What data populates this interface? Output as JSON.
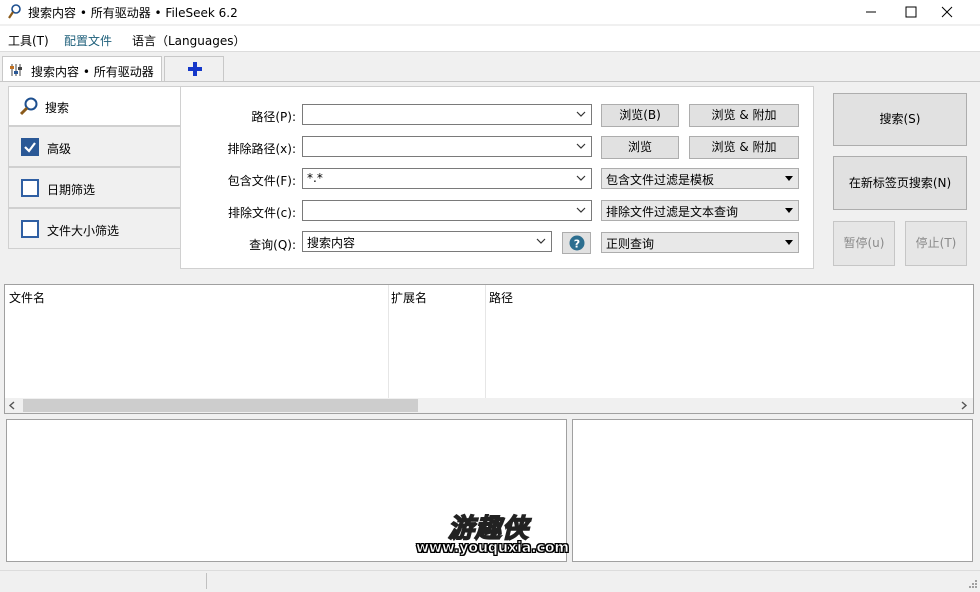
{
  "window": {
    "title": "搜索内容 • 所有驱动器 • FileSeek 6.2"
  },
  "menu": {
    "items": [
      {
        "label": "工具(T)"
      },
      {
        "label": "配置文件"
      },
      {
        "label": "语言（Languages）"
      }
    ]
  },
  "tabs": {
    "active_label": "搜索内容 • 所有驱动器"
  },
  "side_tabs": [
    {
      "label": "搜索",
      "checked": null
    },
    {
      "label": "高级",
      "checked": true
    },
    {
      "label": "日期筛选",
      "checked": false
    },
    {
      "label": "文件大小筛选",
      "checked": false
    }
  ],
  "form": {
    "path_label": "路径(P):",
    "path_value": "",
    "exclude_path_label": "排除路径(x):",
    "exclude_path_value": "",
    "include_files_label": "包含文件(F):",
    "include_files_value": "*.*",
    "exclude_files_label": "排除文件(c):",
    "exclude_files_value": "",
    "query_label": "查询(Q):",
    "query_value": "搜索内容",
    "browse_b": "浏览(B)",
    "browse_append": "浏览 & 附加",
    "browse": "浏览",
    "browse_append_2": "浏览 & 附加",
    "include_mode": "包含文件过滤是模板",
    "exclude_mode": "排除文件过滤是文本查询",
    "query_mode": "正则查询"
  },
  "actions": {
    "search": "搜索(S)",
    "search_new_tab": "在新标签页搜索(N)",
    "pause": "暂停(u)",
    "stop": "停止(T)"
  },
  "results": {
    "columns": [
      "文件名",
      "扩展名",
      "路径"
    ]
  },
  "watermark": {
    "title": "游趣侠",
    "url": "www.youquxia.com"
  },
  "colors": {
    "checkbox_accent": "#2a5896",
    "plus_icon": "#1537c9",
    "help_icon_bg": "#2c6e8f"
  }
}
